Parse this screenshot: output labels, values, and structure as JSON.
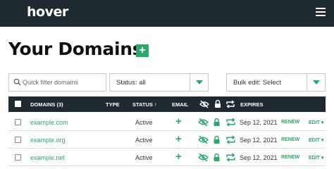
{
  "header": {
    "logo": "hover"
  },
  "page": {
    "title": "Your Domains",
    "add_label": "+"
  },
  "toolbar": {
    "filter_placeholder": "Quick filter domains",
    "status_select": "Status: all",
    "bulk_select": "Bulk edit: Select"
  },
  "table": {
    "headers": {
      "domains": "DOMAINS (3)",
      "type": "TYPE",
      "status": "STATUS ↑",
      "email": "EMAIL",
      "expires": "EXPIRES"
    },
    "rows": [
      {
        "domain": "example.com",
        "type": "",
        "status": "Active",
        "email": "+",
        "expires": "Sep 12, 2021",
        "renew": "RENEW",
        "edit": "EDIT"
      },
      {
        "domain": "example.org",
        "type": "",
        "status": "Active",
        "email": "+",
        "expires": "Sep 12, 2021",
        "renew": "RENEW",
        "edit": "EDIT"
      },
      {
        "domain": "example.net",
        "type": "",
        "status": "Active",
        "email": "+",
        "expires": "Sep 12, 2021",
        "renew": "RENEW",
        "edit": "EDIT"
      }
    ]
  },
  "colors": {
    "accent": "#2ca868",
    "header_bg": "#1f2a30"
  },
  "icons": [
    "hamburger-menu-icon",
    "search-icon",
    "chevron-down-icon",
    "eye-slash-icon",
    "lock-icon",
    "repeat-icon"
  ]
}
